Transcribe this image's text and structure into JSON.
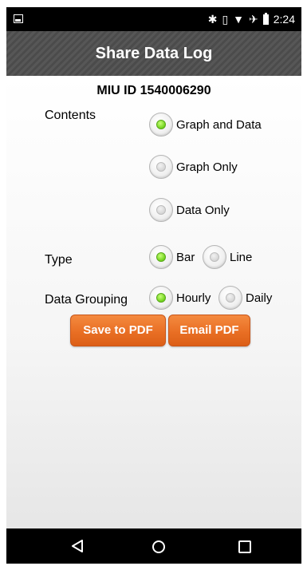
{
  "status_bar": {
    "time": "2:24",
    "icons": [
      "gallery-icon",
      "bluetooth-icon",
      "vibrate-icon",
      "wifi-icon",
      "airplane-icon",
      "battery-icon"
    ]
  },
  "header": {
    "title": "Share Data Log"
  },
  "miu": {
    "label": "MIU ID 1540006290"
  },
  "contents": {
    "label": "Contents",
    "options": [
      {
        "label": "Graph and Data",
        "selected": true
      },
      {
        "label": "Graph Only",
        "selected": false
      },
      {
        "label": "Data Only",
        "selected": false
      }
    ]
  },
  "type": {
    "label": "Type",
    "options": [
      {
        "label": "Bar",
        "selected": true
      },
      {
        "label": "Line",
        "selected": false
      }
    ]
  },
  "grouping": {
    "label": "Data Grouping",
    "options": [
      {
        "label": "Hourly",
        "selected": true
      },
      {
        "label": "Daily",
        "selected": false
      }
    ]
  },
  "actions": {
    "save_pdf": "Save to PDF",
    "email_pdf": "Email PDF"
  },
  "colors": {
    "accent_button": "#e96f24",
    "radio_selected": "#6fd21a",
    "title_bar": "#505050"
  }
}
